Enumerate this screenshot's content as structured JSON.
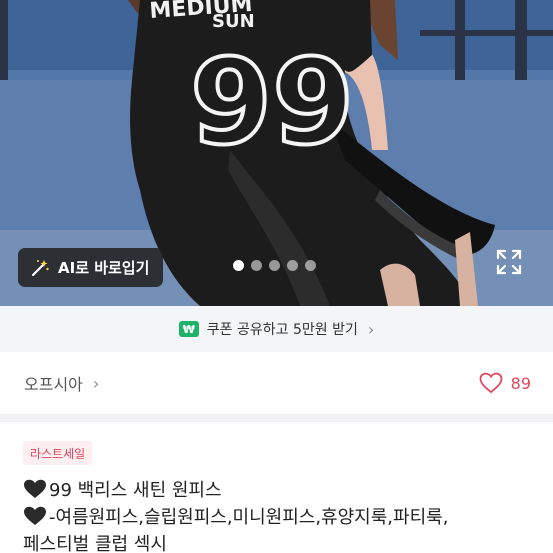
{
  "hero": {
    "ai_button_label": "AI로 바로입기",
    "carousel": {
      "total": 5,
      "active": 0
    },
    "shirt_text": {
      "word": "SUN",
      "number": "99",
      "top_word": "MEDIUM"
    }
  },
  "coupon": {
    "badge": "₩",
    "text": "쿠폰 공유하고 5만원 받기",
    "chevron": "›"
  },
  "shop": {
    "name": "오프시아",
    "chevron": "›",
    "likes": "89"
  },
  "product": {
    "tag": "라스트세일",
    "title_line1": "99 백리스 새틴 원피스",
    "title_line2": "-여름원피스,슬립원피스,미니원피스,휴양지룩,파티룩,",
    "title_line3": "페스티벌 클럽 섹시"
  },
  "colors": {
    "accent_pink": "#e1485f",
    "coupon_green": "#1fb36a",
    "tag_bg": "#fdeef0"
  }
}
